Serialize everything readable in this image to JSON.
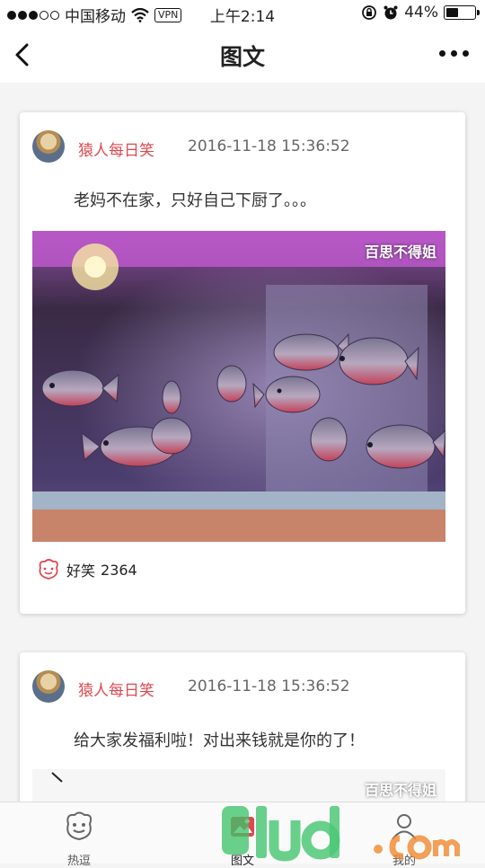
{
  "status_bar": {
    "carrier": "中国移动",
    "vpn": "VPN",
    "time": "上午2:14",
    "battery": "44%",
    "battery_level": 0.44
  },
  "nav": {
    "title": "图文"
  },
  "posts": [
    {
      "author": "猿人每日笑",
      "time": "2016-11-18 15:36:52",
      "text": "老妈不在家，只好自己下厨了。。。",
      "watermark": "百思不得姐",
      "reaction_label": "好笑",
      "reaction_count": "2364"
    },
    {
      "author": "猿人每日笑",
      "time": "2016-11-18 15:36:52",
      "text": "给大家发福利啦！对出来钱就是你的了！",
      "watermark": "百思不得姐"
    }
  ],
  "tabs": [
    {
      "label": "热逗"
    },
    {
      "label": "图文"
    },
    {
      "label": "我的"
    }
  ],
  "colors": {
    "accent": "#e0484f",
    "brand_green": "#3cc36a",
    "brand_orange": "#f28b32"
  }
}
